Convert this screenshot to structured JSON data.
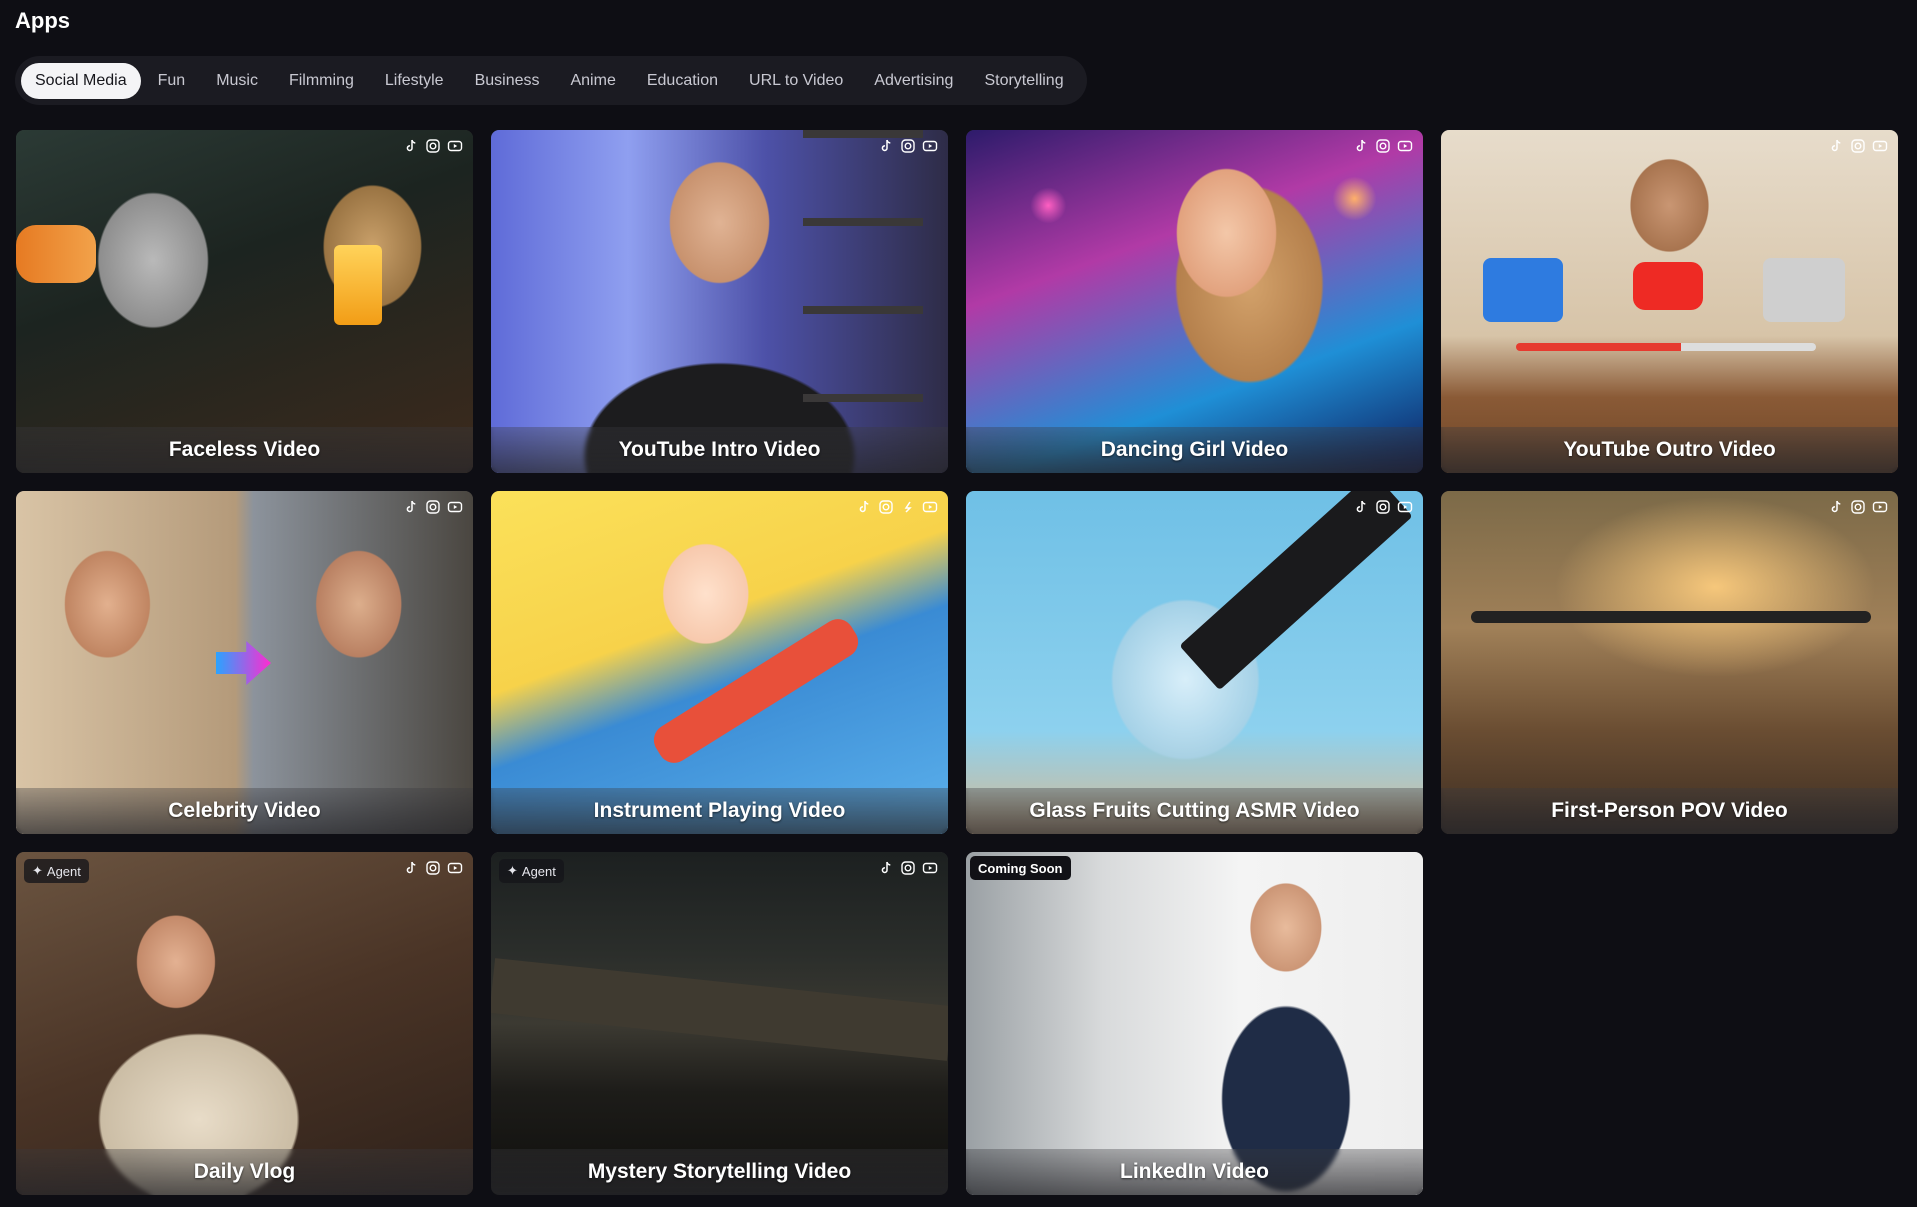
{
  "page": {
    "title": "Apps"
  },
  "tabs": [
    {
      "label": "Social Media",
      "active": true
    },
    {
      "label": "Fun"
    },
    {
      "label": "Music"
    },
    {
      "label": "Filmming"
    },
    {
      "label": "Lifestyle"
    },
    {
      "label": "Business"
    },
    {
      "label": "Anime"
    },
    {
      "label": "Education"
    },
    {
      "label": "URL to Video"
    },
    {
      "label": "Advertising"
    },
    {
      "label": "Storytelling"
    }
  ],
  "cards": [
    {
      "label": "Faceless Video",
      "platforms": [
        "tiktok-icon",
        "instagram-icon",
        "youtube-icon"
      ]
    },
    {
      "label": "YouTube Intro Video",
      "platforms": [
        "tiktok-icon",
        "instagram-icon",
        "youtube-icon"
      ]
    },
    {
      "label": "Dancing Girl Video",
      "platforms": [
        "tiktok-icon",
        "instagram-icon",
        "youtube-icon"
      ]
    },
    {
      "label": "YouTube Outro Video",
      "platforms": [
        "tiktok-icon",
        "instagram-icon",
        "youtube-icon"
      ]
    },
    {
      "label": "Celebrity Video",
      "platforms": [
        "tiktok-icon",
        "instagram-icon",
        "youtube-icon"
      ]
    },
    {
      "label": "Instrument Playing Video",
      "platforms": [
        "tiktok-icon",
        "instagram-icon",
        "threads-icon",
        "youtube-icon"
      ]
    },
    {
      "label": "Glass Fruits Cutting ASMR Video",
      "platforms": [
        "tiktok-icon",
        "instagram-icon",
        "youtube-icon"
      ]
    },
    {
      "label": "First-Person POV Video",
      "platforms": [
        "tiktok-icon",
        "instagram-icon",
        "youtube-icon"
      ]
    },
    {
      "label": "Daily Vlog",
      "badge": "Agent",
      "platforms": [
        "tiktok-icon",
        "instagram-icon",
        "youtube-icon"
      ]
    },
    {
      "label": "Mystery Storytelling Video",
      "badge": "Agent",
      "platforms": [
        "tiktok-icon",
        "instagram-icon",
        "youtube-icon"
      ]
    },
    {
      "label": "LinkedIn Video",
      "badge": "Coming Soon",
      "platforms": []
    }
  ],
  "colors": {
    "background": "#0e0e14",
    "tab_bar": "#1b1b22",
    "tab_active": "#f4f4f6"
  }
}
